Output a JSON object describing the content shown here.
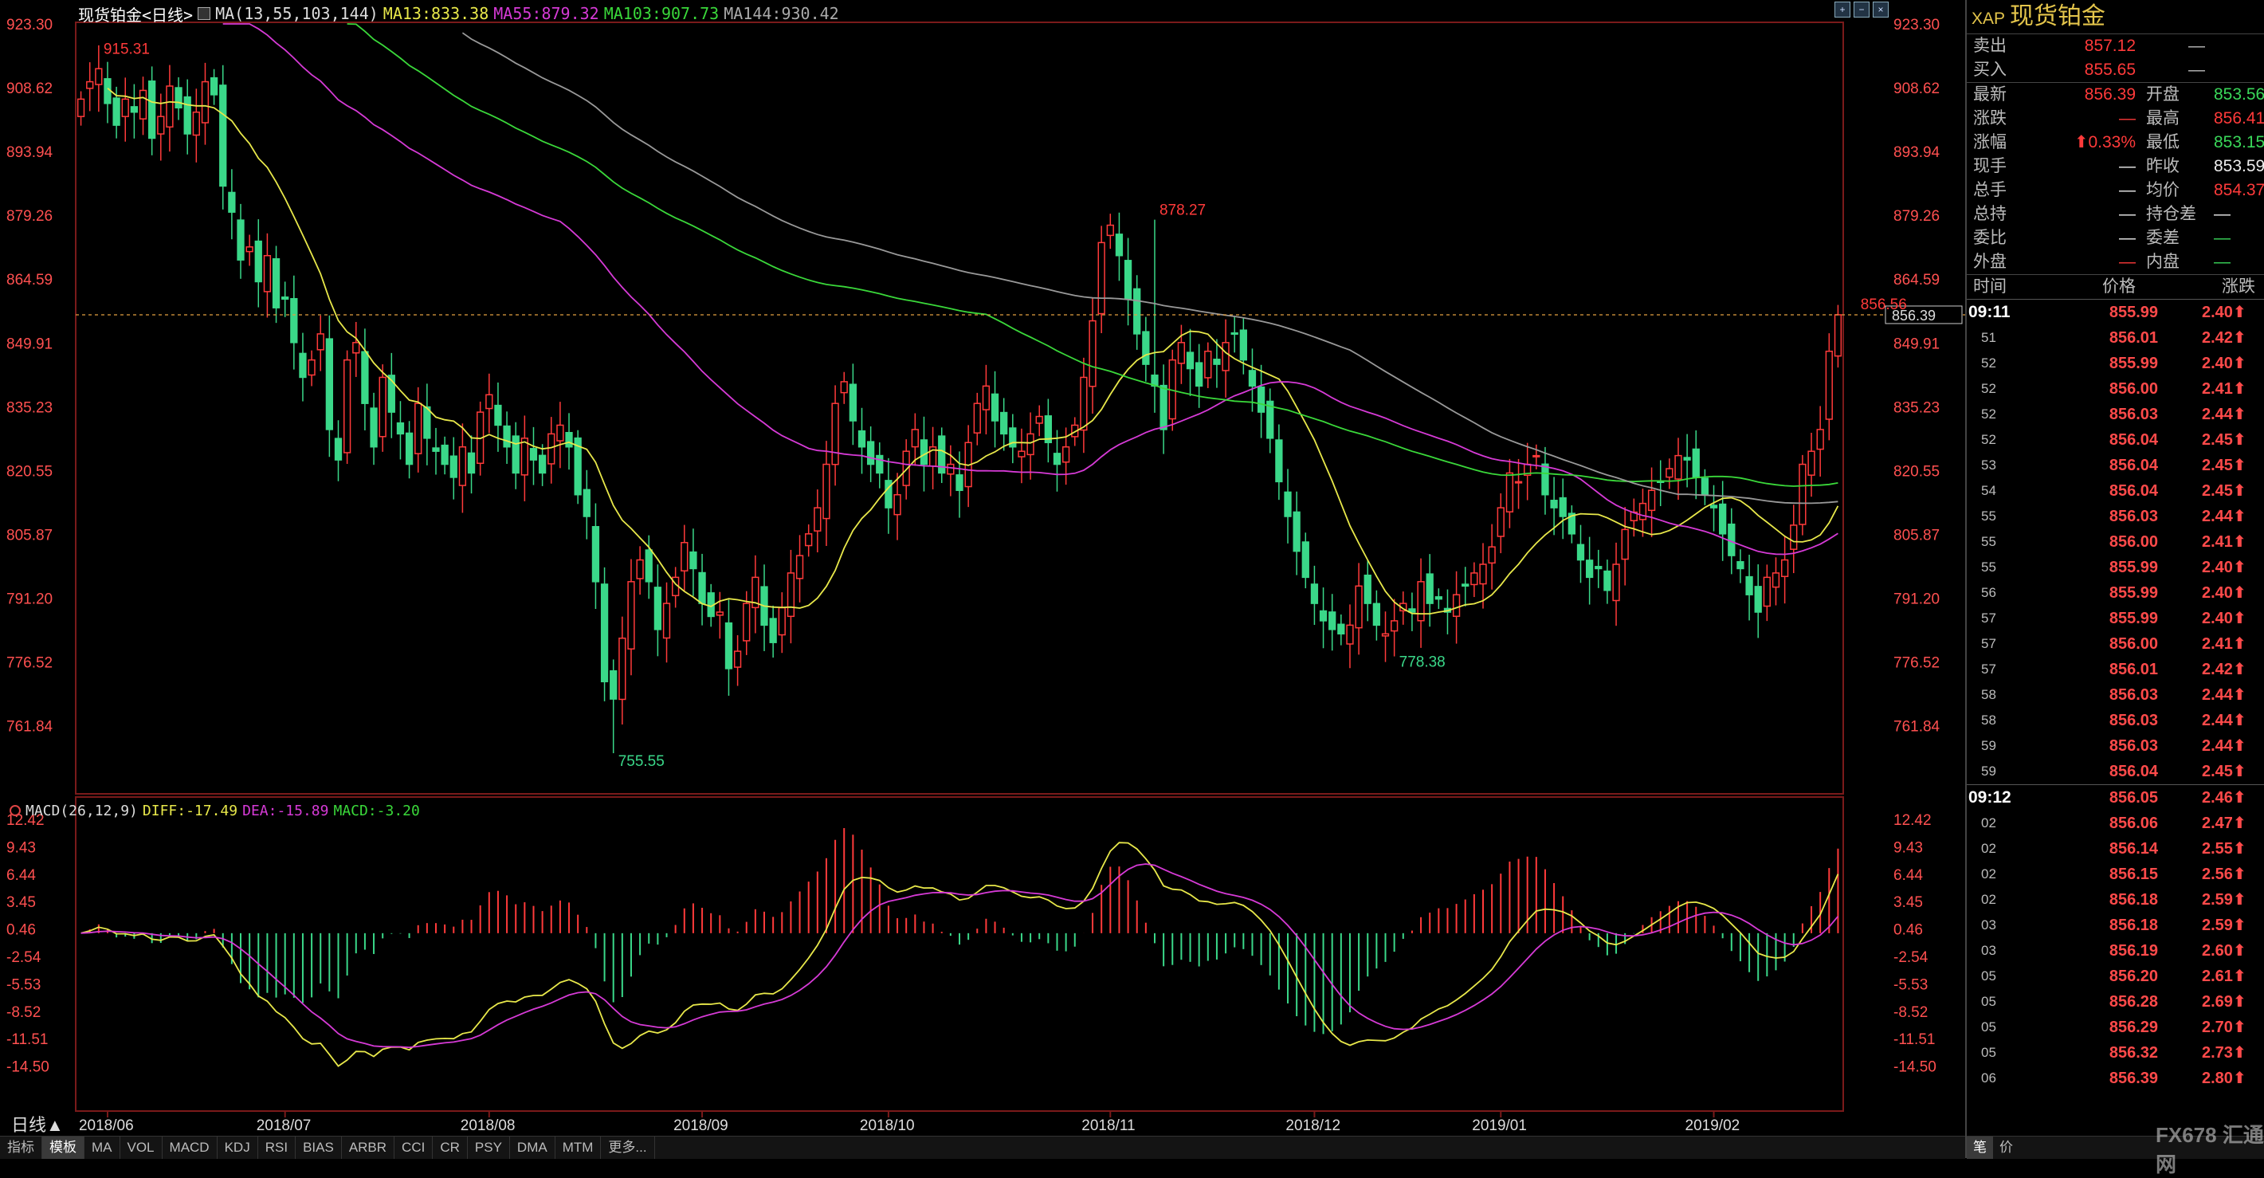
{
  "chart_header": {
    "title": "现货铂金<日线>",
    "ma_label": "MA(13,55,103,144)",
    "ma13": "MA13:833.38",
    "ma55": "MA55:879.32",
    "ma103": "MA103:907.73",
    "ma144": "MA144:930.42"
  },
  "macd_header": {
    "label": "MACD(26,12,9)",
    "diff": "DIFF:-17.49",
    "dea": "DEA:-15.89",
    "macd": "MACD:-3.20"
  },
  "colors": {
    "up": "#ff3a3a",
    "down": "#3ad889",
    "ma13": "#e8e84a",
    "ma55": "#d63ad6",
    "ma103": "#3ad83a",
    "ma144": "#999999",
    "diff": "#e8e84a",
    "dea": "#d63ad6",
    "accent_gold": "#e4c54b"
  },
  "period_label": "日线▲",
  "bottom_tabs": [
    "指标",
    "模板",
    "MA",
    "VOL",
    "MACD",
    "KDJ",
    "RSI",
    "BIAS",
    "ARBR",
    "CCI",
    "CR",
    "PSY",
    "DMA",
    "MTM",
    "更多..."
  ],
  "chart_data": [
    {
      "type": "candlestick",
      "title": "现货铂金<日线>",
      "ylim": [
        755.55,
        923.3
      ],
      "y_ticks": [
        "923.30",
        "908.62",
        "893.94",
        "879.26",
        "864.59",
        "849.91",
        "835.23",
        "820.55",
        "805.87",
        "791.20",
        "776.52",
        "761.84"
      ],
      "y_tick_values": [
        923.3,
        908.62,
        893.94,
        879.26,
        864.59,
        849.91,
        835.23,
        820.55,
        805.87,
        791.2,
        776.52,
        761.84
      ],
      "x_labels": [
        "2018/06",
        "2018/07",
        "2018/08",
        "2018/09",
        "2018/10",
        "2018/11",
        "2018/12",
        "2019/01",
        "2019/02"
      ],
      "x_label_index": [
        3,
        23,
        46,
        70,
        91,
        116,
        139,
        160,
        184
      ],
      "annotations": [
        {
          "text": "915.31",
          "index": 2,
          "value": 915.31,
          "color": "#ff3a3a"
        },
        {
          "text": "878.27",
          "index": 121,
          "value": 878.27,
          "color": "#ff3a3a"
        },
        {
          "text": "755.55",
          "index": 60,
          "value": 755.55,
          "color": "#3ad889"
        },
        {
          "text": "778.38",
          "index": 148,
          "value": 778.38,
          "color": "#3ad889"
        },
        {
          "text": "856.56",
          "index": 200,
          "value": 856.56,
          "color": "#ff3a3a"
        }
      ],
      "current_price": {
        "text": "856.39",
        "value": 856.39
      },
      "closes": [
        906,
        910,
        913,
        905,
        900,
        906,
        903,
        908,
        897,
        902,
        909,
        904,
        898,
        903,
        910,
        907,
        886,
        880,
        869,
        872,
        864,
        870,
        858,
        860,
        850,
        842,
        846,
        852,
        830,
        823,
        846,
        850,
        836,
        826,
        842,
        834,
        829,
        822,
        836,
        828,
        825,
        822,
        819,
        826,
        820,
        834,
        838,
        831,
        826,
        820,
        828,
        823,
        820,
        829,
        831,
        826,
        815,
        810,
        795,
        772,
        768,
        782,
        795,
        800,
        795,
        784,
        790,
        796,
        804,
        798,
        790,
        787,
        788,
        775,
        779,
        790,
        796,
        785,
        781,
        789,
        797,
        801,
        806,
        812,
        822,
        836,
        841,
        832,
        826,
        822,
        820,
        812,
        815,
        825,
        830,
        822,
        826,
        820,
        822,
        816,
        827,
        836,
        840,
        832,
        829,
        826,
        825,
        829,
        833,
        827,
        822,
        826,
        831,
        842,
        855,
        873,
        877,
        870,
        860,
        852,
        845,
        840,
        830,
        846,
        850,
        844,
        840,
        848,
        845,
        850,
        852,
        846,
        840,
        834,
        828,
        818,
        810,
        802,
        796,
        790,
        786,
        784,
        783,
        785,
        794,
        790,
        785,
        783,
        786,
        790,
        788,
        795,
        790,
        791,
        788,
        792,
        794,
        797,
        799,
        803,
        812,
        820,
        818,
        822,
        824,
        815,
        812,
        810,
        806,
        800,
        796,
        798,
        793,
        799,
        807,
        811,
        813,
        816,
        818,
        821,
        824,
        823,
        819,
        815,
        812,
        806,
        801,
        798,
        792,
        788,
        796,
        797,
        800,
        808,
        822,
        825,
        830,
        848,
        856.39
      ],
      "macd_ylim": [
        -17.49,
        12.42
      ],
      "macd_ticks": [
        "12.42",
        "9.43",
        "6.44",
        "3.45",
        "0.46",
        "-2.54",
        "-5.53",
        "-8.52",
        "-11.51",
        "-14.50"
      ],
      "macd_tick_values": [
        12.42,
        9.43,
        6.44,
        3.45,
        0.46,
        -2.54,
        -5.53,
        -8.52,
        -11.51,
        -14.5
      ],
      "series": [
        {
          "name": "MA13",
          "values_from": "closes",
          "period": 13
        },
        {
          "name": "MA55",
          "values_from": "closes",
          "period": 55
        },
        {
          "name": "MA103",
          "values_from": "closes",
          "period": 103
        },
        {
          "name": "MA144",
          "values_from": "closes",
          "period": 144
        },
        {
          "name": "DIFF"
        },
        {
          "name": "DEA"
        },
        {
          "name": "MACD"
        }
      ]
    }
  ],
  "quote": {
    "code": "XAP",
    "name": "现货铂金",
    "sell_label": "卖出",
    "sell": "857.12",
    "sell_vol": "—",
    "buy_label": "买入",
    "buy": "855.65",
    "buy_vol": "—",
    "rows": [
      {
        "l": "最新",
        "v": "856.39",
        "vc": "red",
        "l2": "开盘",
        "v2": "853.56",
        "v2c": "green"
      },
      {
        "l": "涨跌",
        "v": "—",
        "vc": "red",
        "l2": "最高",
        "v2": "856.41",
        "v2c": "red"
      },
      {
        "l": "涨幅",
        "v": "⬆0.33%",
        "vc": "red",
        "l2": "最低",
        "v2": "853.15",
        "v2c": "green"
      },
      {
        "l": "现手",
        "v": "—",
        "vc": "white",
        "l2": "昨收",
        "v2": "853.59",
        "v2c": "white"
      },
      {
        "l": "总手",
        "v": "—",
        "vc": "white",
        "l2": "均价",
        "v2": "854.37",
        "v2c": "red"
      },
      {
        "l": "总持",
        "v": "—",
        "vc": "white",
        "l2": "持仓差",
        "v2": "—",
        "v2c": "white"
      },
      {
        "l": "委比",
        "v": "—",
        "vc": "white",
        "l2": "委差",
        "v2": "—",
        "v2c": "green"
      },
      {
        "l": "外盘",
        "v": "—",
        "vc": "red",
        "l2": "内盘",
        "v2": "—",
        "v2c": "green"
      }
    ],
    "tick_head": {
      "time": "时间",
      "price": "价格",
      "change": "涨跌"
    },
    "ticks": [
      {
        "t": "09:11",
        "full": true,
        "p": "855.99",
        "c": "2.40"
      },
      {
        "t": "51",
        "p": "856.01",
        "c": "2.42"
      },
      {
        "t": "52",
        "p": "855.99",
        "c": "2.40"
      },
      {
        "t": "52",
        "p": "856.00",
        "c": "2.41"
      },
      {
        "t": "52",
        "p": "856.03",
        "c": "2.44"
      },
      {
        "t": "52",
        "p": "856.04",
        "c": "2.45"
      },
      {
        "t": "53",
        "p": "856.04",
        "c": "2.45"
      },
      {
        "t": "54",
        "p": "856.04",
        "c": "2.45"
      },
      {
        "t": "55",
        "p": "856.03",
        "c": "2.44"
      },
      {
        "t": "55",
        "p": "856.00",
        "c": "2.41"
      },
      {
        "t": "55",
        "p": "855.99",
        "c": "2.40"
      },
      {
        "t": "56",
        "p": "855.99",
        "c": "2.40"
      },
      {
        "t": "57",
        "p": "855.99",
        "c": "2.40"
      },
      {
        "t": "57",
        "p": "856.00",
        "c": "2.41"
      },
      {
        "t": "57",
        "p": "856.01",
        "c": "2.42"
      },
      {
        "t": "58",
        "p": "856.03",
        "c": "2.44"
      },
      {
        "t": "58",
        "p": "856.03",
        "c": "2.44"
      },
      {
        "t": "59",
        "p": "856.03",
        "c": "2.44"
      },
      {
        "t": "59",
        "p": "856.04",
        "c": "2.45"
      },
      {
        "t": "09:12",
        "full": true,
        "p": "856.05",
        "c": "2.46"
      },
      {
        "t": "02",
        "p": "856.06",
        "c": "2.47"
      },
      {
        "t": "02",
        "p": "856.14",
        "c": "2.55"
      },
      {
        "t": "02",
        "p": "856.15",
        "c": "2.56"
      },
      {
        "t": "02",
        "p": "856.18",
        "c": "2.59"
      },
      {
        "t": "03",
        "p": "856.18",
        "c": "2.59"
      },
      {
        "t": "03",
        "p": "856.19",
        "c": "2.60"
      },
      {
        "t": "05",
        "p": "856.20",
        "c": "2.61"
      },
      {
        "t": "05",
        "p": "856.28",
        "c": "2.69"
      },
      {
        "t": "05",
        "p": "856.29",
        "c": "2.70"
      },
      {
        "t": "05",
        "p": "856.32",
        "c": "2.73"
      },
      {
        "t": "06",
        "p": "856.39",
        "c": "2.80"
      }
    ],
    "bottom_tabs": [
      "笔",
      "价"
    ]
  },
  "watermark": "FX678 汇通网"
}
